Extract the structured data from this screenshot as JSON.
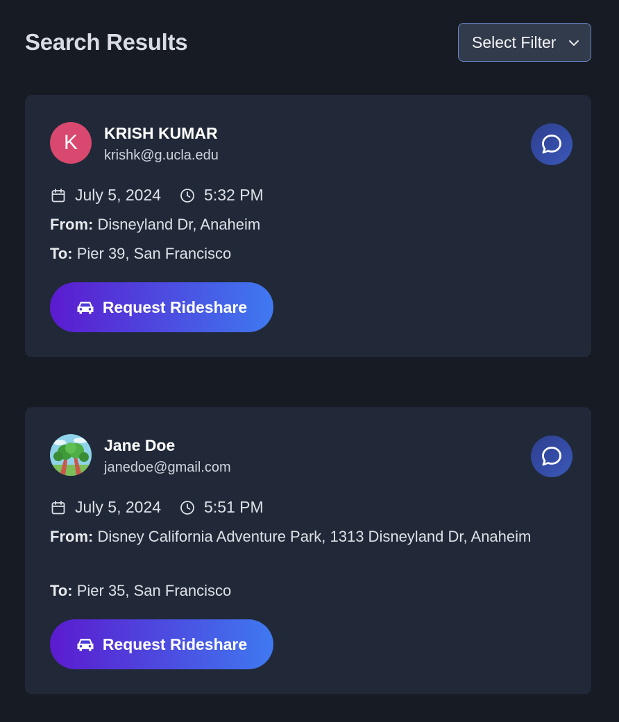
{
  "header": {
    "title": "Search Results",
    "filter_label": "Select Filter"
  },
  "results": [
    {
      "avatar_initial": "K",
      "name": "KRISH KUMAR",
      "email": "krishk@g.ucla.edu",
      "date": "July 5, 2024",
      "time": "5:32 PM",
      "from_label": "From:",
      "from": "Disneyland Dr, Anaheim",
      "to_label": "To:",
      "to": "Pier 39, San Francisco",
      "button_label": "Request Rideshare"
    },
    {
      "name": "Jane Doe",
      "email": "janedoe@gmail.com",
      "date": "July 5, 2024",
      "time": "5:51 PM",
      "from_label": "From:",
      "from": "Disney California Adventure Park, 1313 Disneyland Dr, Anaheim",
      "to_label": "To:",
      "to": "Pier 35, San Francisco",
      "button_label": "Request Rideshare"
    }
  ],
  "icons": {
    "filter": "chevron-down-icon",
    "chat": "chat-bubble-icon",
    "date": "calendar-icon",
    "time": "clock-icon",
    "button": "car-icon"
  },
  "colors": {
    "background": "#161b24",
    "card": "#212938",
    "avatar_initial_bg": "#d9486e",
    "button_gradient_start": "#5b1bcf",
    "button_gradient_end": "#3f79f0",
    "chat_button": "#3a57b8"
  }
}
